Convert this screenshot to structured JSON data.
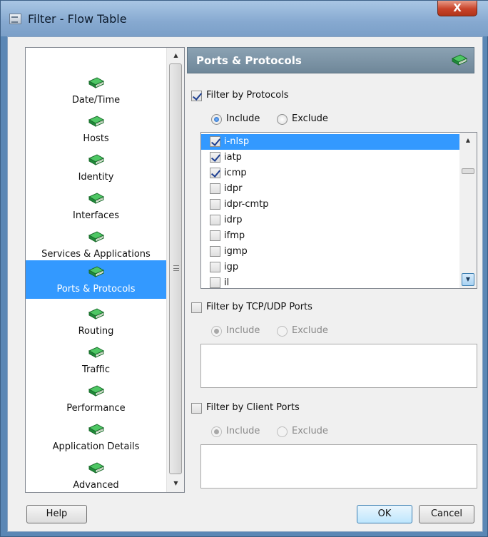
{
  "window": {
    "title": "Filter - Flow Table",
    "close_label": "X"
  },
  "nav": {
    "items": [
      {
        "label": "Date/Time",
        "icon": "book-icon"
      },
      {
        "label": "Hosts",
        "icon": "book-icon"
      },
      {
        "label": "Identity",
        "icon": "book-icon"
      },
      {
        "label": "Interfaces",
        "icon": "book-icon"
      },
      {
        "label": "Services & Applications",
        "icon": "book-icon"
      },
      {
        "label": "Ports & Protocols",
        "icon": "book-icon",
        "selected": true
      },
      {
        "label": "Routing",
        "icon": "book-icon"
      },
      {
        "label": "Traffic",
        "icon": "book-icon"
      },
      {
        "label": "Performance",
        "icon": "book-icon"
      },
      {
        "label": "Application Details",
        "icon": "book-icon"
      },
      {
        "label": "Advanced",
        "icon": "book-icon"
      }
    ]
  },
  "panel": {
    "title": "Ports & Protocols",
    "protocols": {
      "label": "Filter by Protocols",
      "checked": true,
      "include_label": "Include",
      "exclude_label": "Exclude",
      "mode": "include",
      "items": [
        {
          "name": "i-nlsp",
          "checked": true,
          "selected": true
        },
        {
          "name": "iatp",
          "checked": true
        },
        {
          "name": "icmp",
          "checked": true
        },
        {
          "name": "idpr",
          "checked": false
        },
        {
          "name": "idpr-cmtp",
          "checked": false
        },
        {
          "name": "idrp",
          "checked": false
        },
        {
          "name": "ifmp",
          "checked": false
        },
        {
          "name": "igmp",
          "checked": false
        },
        {
          "name": "igp",
          "checked": false
        },
        {
          "name": "il",
          "checked": false
        }
      ]
    },
    "tcp_udp": {
      "label": "Filter by TCP/UDP Ports",
      "checked": false,
      "include_label": "Include",
      "exclude_label": "Exclude"
    },
    "client_ports": {
      "label": "Filter by Client Ports",
      "checked": false,
      "include_label": "Include",
      "exclude_label": "Exclude"
    }
  },
  "buttons": {
    "help": "Help",
    "ok": "OK",
    "cancel": "Cancel"
  },
  "colors": {
    "selection": "#3399ff",
    "header": "#7b93a5",
    "book": "#2fa84a"
  }
}
